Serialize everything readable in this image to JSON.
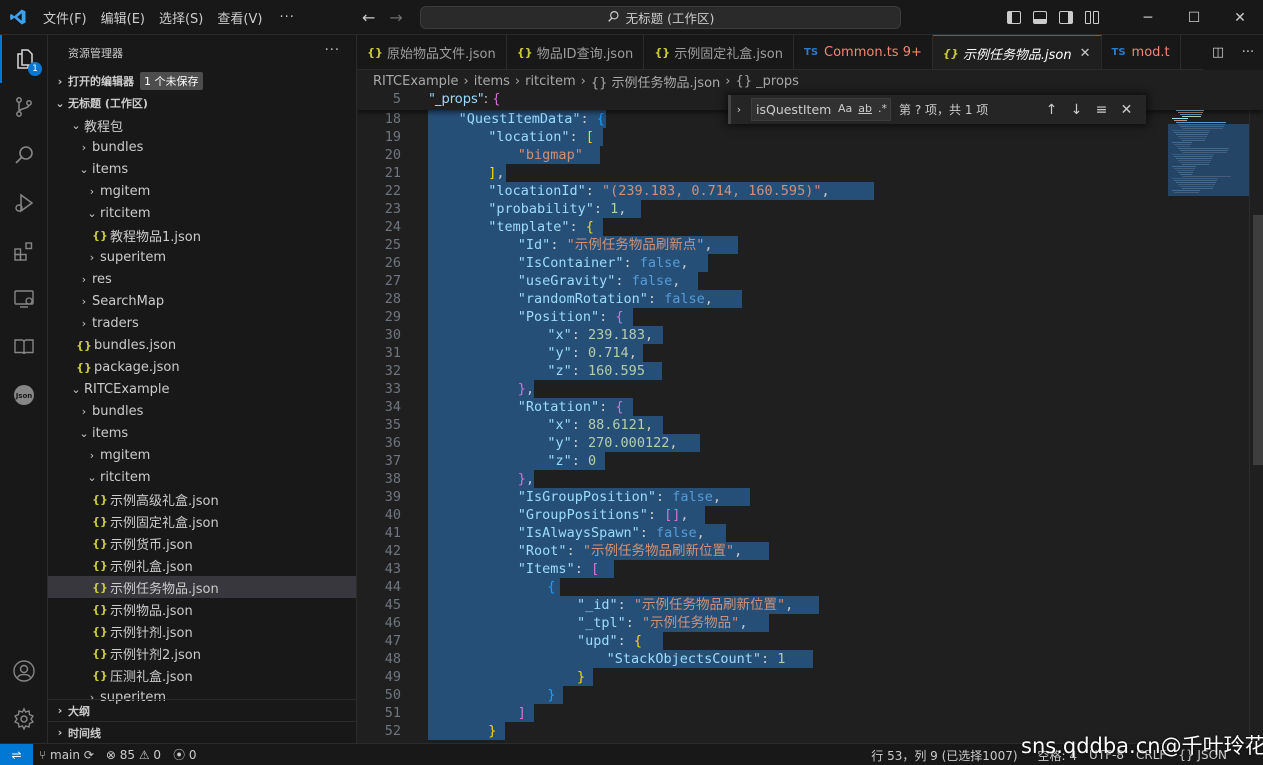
{
  "titlebar": {
    "menus": [
      "文件(F)",
      "编辑(E)",
      "选择(S)",
      "查看(V)"
    ],
    "more": "···",
    "search": "无标题 (工作区)"
  },
  "activity": {
    "badge": "1"
  },
  "sidebar": {
    "title": "资源管理器",
    "more": "···",
    "open_editors": "打开的编辑器",
    "unsaved": "1 个未保存",
    "workspace": "无标题 (工作区)",
    "tree": [
      {
        "label": "教程包",
        "depth": 1,
        "type": "folder",
        "open": true
      },
      {
        "label": "bundles",
        "depth": 2,
        "type": "folder",
        "open": false
      },
      {
        "label": "items",
        "depth": 2,
        "type": "folder",
        "open": true
      },
      {
        "label": "mgitem",
        "depth": 3,
        "type": "folder",
        "open": false
      },
      {
        "label": "ritcitem",
        "depth": 3,
        "type": "folder",
        "open": true
      },
      {
        "label": "教程物品1.json",
        "depth": 4,
        "type": "json"
      },
      {
        "label": "superitem",
        "depth": 3,
        "type": "folder",
        "open": false
      },
      {
        "label": "res",
        "depth": 2,
        "type": "folder",
        "open": false
      },
      {
        "label": "SearchMap",
        "depth": 2,
        "type": "folder",
        "open": false
      },
      {
        "label": "traders",
        "depth": 2,
        "type": "folder",
        "open": false
      },
      {
        "label": "bundles.json",
        "depth": 2,
        "type": "json"
      },
      {
        "label": "package.json",
        "depth": 2,
        "type": "json"
      },
      {
        "label": "RITCExample",
        "depth": 1,
        "type": "folder",
        "open": true
      },
      {
        "label": "bundles",
        "depth": 2,
        "type": "folder",
        "open": false
      },
      {
        "label": "items",
        "depth": 2,
        "type": "folder",
        "open": true
      },
      {
        "label": "mgitem",
        "depth": 3,
        "type": "folder",
        "open": false
      },
      {
        "label": "ritcitem",
        "depth": 3,
        "type": "folder",
        "open": true
      },
      {
        "label": "示例高级礼盒.json",
        "depth": 4,
        "type": "json"
      },
      {
        "label": "示例固定礼盒.json",
        "depth": 4,
        "type": "json"
      },
      {
        "label": "示例货币.json",
        "depth": 4,
        "type": "json"
      },
      {
        "label": "示例礼盒.json",
        "depth": 4,
        "type": "json"
      },
      {
        "label": "示例任务物品.json",
        "depth": 4,
        "type": "json",
        "selected": true
      },
      {
        "label": "示例物品.json",
        "depth": 4,
        "type": "json"
      },
      {
        "label": "示例针剂.json",
        "depth": 4,
        "type": "json"
      },
      {
        "label": "示例针剂2.json",
        "depth": 4,
        "type": "json"
      },
      {
        "label": "压测礼盒.json",
        "depth": 4,
        "type": "json"
      },
      {
        "label": "superitem",
        "depth": 3,
        "type": "folder",
        "open": false
      }
    ],
    "outline": "大纲",
    "timeline": "时间线"
  },
  "tabs": [
    {
      "label": "原始物品文件.json",
      "kind": "json"
    },
    {
      "label": "物品ID查询.json",
      "kind": "json"
    },
    {
      "label": "示例固定礼盒.json",
      "kind": "json"
    },
    {
      "label": "Common.ts 9+",
      "kind": "ts",
      "error": true
    },
    {
      "label": "示例任务物品.json",
      "kind": "json",
      "active": true
    },
    {
      "label": "mod.t",
      "kind": "ts",
      "error": true
    }
  ],
  "breadcrumb": [
    "RITCExample",
    "items",
    "ritcitem",
    "{} 示例任务物品.json",
    "{} _props"
  ],
  "find": {
    "query": "isQuestItem",
    "opts": [
      "Aa",
      "ab",
      ".*"
    ],
    "result": "第 ? 项，共 1 项"
  },
  "editor": {
    "sticky": {
      "ln": "5",
      "indent": 1,
      "parts": [
        [
          "k",
          "\"_props\""
        ],
        [
          "p",
          ": "
        ],
        [
          "br2",
          "{"
        ]
      ]
    },
    "lines": [
      {
        "ln": "18",
        "indent": 2,
        "sel": [
          0,
          178
        ],
        "parts": [
          [
            "k",
            "\"QuestItemData\""
          ],
          [
            "p",
            ": "
          ],
          [
            "br3",
            "{"
          ]
        ]
      },
      {
        "ln": "19",
        "indent": 3,
        "sel": [
          0,
          175
        ],
        "parts": [
          [
            "k",
            "\"location\""
          ],
          [
            "p",
            ": "
          ],
          [
            "br1",
            "["
          ]
        ]
      },
      {
        "ln": "20",
        "indent": 4,
        "sel": [
          0,
          172
        ],
        "parts": [
          [
            "s",
            "\"bigmap\""
          ]
        ]
      },
      {
        "ln": "21",
        "indent": 3,
        "sel": [
          0,
          78
        ],
        "parts": [
          [
            "br1",
            "]"
          ],
          [
            "p",
            ","
          ]
        ]
      },
      {
        "ln": "22",
        "indent": 3,
        "sel": [
          0,
          446
        ],
        "parts": [
          [
            "k",
            "\"locationId\""
          ],
          [
            "p",
            ": "
          ],
          [
            "s",
            "\"(239.183, 0.714, 160.595)\""
          ],
          [
            "p",
            ","
          ]
        ]
      },
      {
        "ln": "23",
        "indent": 3,
        "sel": [
          0,
          213
        ],
        "parts": [
          [
            "k",
            "\"probability\""
          ],
          [
            "p",
            ": "
          ],
          [
            "n",
            "1"
          ],
          [
            "p",
            ","
          ]
        ]
      },
      {
        "ln": "24",
        "indent": 3,
        "sel": [
          0,
          175
        ],
        "parts": [
          [
            "k",
            "\"template\""
          ],
          [
            "p",
            ": "
          ],
          [
            "br1",
            "{"
          ]
        ]
      },
      {
        "ln": "25",
        "indent": 4,
        "sel": [
          0,
          310
        ],
        "parts": [
          [
            "k",
            "\"Id\""
          ],
          [
            "p",
            ": "
          ],
          [
            "s",
            "\"示例任务物品刷新点\""
          ],
          [
            "p",
            ","
          ]
        ]
      },
      {
        "ln": "26",
        "indent": 4,
        "sel": [
          0,
          280
        ],
        "parts": [
          [
            "k",
            "\"IsContainer\""
          ],
          [
            "p",
            ": "
          ],
          [
            "b",
            "false"
          ],
          [
            "p",
            ","
          ]
        ]
      },
      {
        "ln": "27",
        "indent": 4,
        "sel": [
          0,
          270
        ],
        "parts": [
          [
            "k",
            "\"useGravity\""
          ],
          [
            "p",
            ": "
          ],
          [
            "b",
            "false"
          ],
          [
            "p",
            ","
          ]
        ]
      },
      {
        "ln": "28",
        "indent": 4,
        "sel": [
          0,
          314
        ],
        "parts": [
          [
            "k",
            "\"randomRotation\""
          ],
          [
            "p",
            ": "
          ],
          [
            "b",
            "false"
          ],
          [
            "p",
            ","
          ]
        ]
      },
      {
        "ln": "29",
        "indent": 4,
        "sel": [
          0,
          205
        ],
        "parts": [
          [
            "k",
            "\"Position\""
          ],
          [
            "p",
            ": "
          ],
          [
            "br2",
            "{"
          ]
        ]
      },
      {
        "ln": "30",
        "indent": 5,
        "sel": [
          0,
          235
        ],
        "parts": [
          [
            "k",
            "\"x\""
          ],
          [
            "p",
            ": "
          ],
          [
            "n",
            "239.183"
          ],
          [
            "p",
            ","
          ]
        ]
      },
      {
        "ln": "31",
        "indent": 5,
        "sel": [
          0,
          215
        ],
        "parts": [
          [
            "k",
            "\"y\""
          ],
          [
            "p",
            ": "
          ],
          [
            "n",
            "0.714"
          ],
          [
            "p",
            ","
          ]
        ]
      },
      {
        "ln": "32",
        "indent": 5,
        "sel": [
          0,
          234
        ],
        "parts": [
          [
            "k",
            "\"z\""
          ],
          [
            "p",
            ": "
          ],
          [
            "n",
            "160.595"
          ]
        ]
      },
      {
        "ln": "33",
        "indent": 4,
        "sel": [
          0,
          106
        ],
        "parts": [
          [
            "br2",
            "}"
          ],
          [
            "p",
            ","
          ]
        ]
      },
      {
        "ln": "34",
        "indent": 4,
        "sel": [
          0,
          205
        ],
        "parts": [
          [
            "k",
            "\"Rotation\""
          ],
          [
            "p",
            ": "
          ],
          [
            "br2",
            "{"
          ]
        ]
      },
      {
        "ln": "35",
        "indent": 5,
        "sel": [
          0,
          235
        ],
        "parts": [
          [
            "k",
            "\"x\""
          ],
          [
            "p",
            ": "
          ],
          [
            "n",
            "88.6121"
          ],
          [
            "p",
            ","
          ]
        ]
      },
      {
        "ln": "36",
        "indent": 5,
        "sel": [
          0,
          272
        ],
        "parts": [
          [
            "k",
            "\"y\""
          ],
          [
            "p",
            ": "
          ],
          [
            "n",
            "270.000122"
          ],
          [
            "p",
            ","
          ]
        ]
      },
      {
        "ln": "37",
        "indent": 5,
        "sel": [
          0,
          177
        ],
        "parts": [
          [
            "k",
            "\"z\""
          ],
          [
            "p",
            ": "
          ],
          [
            "n",
            "0"
          ]
        ]
      },
      {
        "ln": "38",
        "indent": 4,
        "sel": [
          0,
          106
        ],
        "parts": [
          [
            "br2",
            "}"
          ],
          [
            "p",
            ","
          ]
        ]
      },
      {
        "ln": "39",
        "indent": 4,
        "sel": [
          0,
          322
        ],
        "parts": [
          [
            "k",
            "\"IsGroupPosition\""
          ],
          [
            "p",
            ": "
          ],
          [
            "b",
            "false"
          ],
          [
            "p",
            ","
          ]
        ]
      },
      {
        "ln": "40",
        "indent": 4,
        "sel": [
          0,
          277
        ],
        "parts": [
          [
            "k",
            "\"GroupPositions\""
          ],
          [
            "p",
            ": "
          ],
          [
            "br2",
            "[]"
          ],
          [
            "p",
            ","
          ]
        ]
      },
      {
        "ln": "41",
        "indent": 4,
        "sel": [
          0,
          298
        ],
        "parts": [
          [
            "k",
            "\"IsAlwaysSpawn\""
          ],
          [
            "p",
            ": "
          ],
          [
            "b",
            "false"
          ],
          [
            "p",
            ","
          ]
        ]
      },
      {
        "ln": "42",
        "indent": 4,
        "sel": [
          0,
          341
        ],
        "parts": [
          [
            "k",
            "\"Root\""
          ],
          [
            "p",
            ": "
          ],
          [
            "s",
            "\"示例任务物品刷新位置\""
          ],
          [
            "p",
            ","
          ]
        ]
      },
      {
        "ln": "43",
        "indent": 4,
        "sel": [
          0,
          186
        ],
        "parts": [
          [
            "k",
            "\"Items\""
          ],
          [
            "p",
            ": "
          ],
          [
            "br2",
            "["
          ]
        ]
      },
      {
        "ln": "44",
        "indent": 5,
        "sel": [
          0,
          132
        ],
        "parts": [
          [
            "br3",
            "{"
          ]
        ]
      },
      {
        "ln": "45",
        "indent": 6,
        "sel": [
          0,
          391
        ],
        "parts": [
          [
            "k",
            "\"_id\""
          ],
          [
            "p",
            ": "
          ],
          [
            "s",
            "\"示例任务物品刷新位置\""
          ],
          [
            "p",
            ","
          ]
        ]
      },
      {
        "ln": "46",
        "indent": 6,
        "sel": [
          0,
          341
        ],
        "parts": [
          [
            "k",
            "\"_tpl\""
          ],
          [
            "p",
            ": "
          ],
          [
            "s",
            "\"示例任务物品\""
          ],
          [
            "p",
            ","
          ]
        ]
      },
      {
        "ln": "47",
        "indent": 6,
        "sel": [
          0,
          235
        ],
        "parts": [
          [
            "k",
            "\"upd\""
          ],
          [
            "p",
            ": "
          ],
          [
            "br1",
            "{"
          ]
        ]
      },
      {
        "ln": "48",
        "indent": 7,
        "sel": [
          0,
          385
        ],
        "parts": [
          [
            "k",
            "\"StackObjectsCount\""
          ],
          [
            "p",
            ": "
          ],
          [
            "n",
            "1"
          ]
        ]
      },
      {
        "ln": "49",
        "indent": 6,
        "sel": [
          0,
          165
        ],
        "parts": [
          [
            "br1",
            "}"
          ]
        ]
      },
      {
        "ln": "50",
        "indent": 5,
        "sel": [
          0,
          135
        ],
        "parts": [
          [
            "br3",
            "}"
          ]
        ]
      },
      {
        "ln": "51",
        "indent": 4,
        "sel": [
          0,
          106
        ],
        "parts": [
          [
            "br2",
            "]"
          ]
        ]
      },
      {
        "ln": "52",
        "indent": 3,
        "sel": [
          0,
          77
        ],
        "parts": [
          [
            "br1",
            "}"
          ]
        ]
      }
    ]
  },
  "status": {
    "branch": "main",
    "errors": "85",
    "warnings": "0",
    "ports": "0",
    "position": "行 53，列 9 (已选择1007)",
    "spaces": "空格: 4",
    "encoding": "UTF-8",
    "eol": "CRLF",
    "lang": "{} JSON"
  },
  "watermark": "sns.qddba.cn@千叶玲花"
}
